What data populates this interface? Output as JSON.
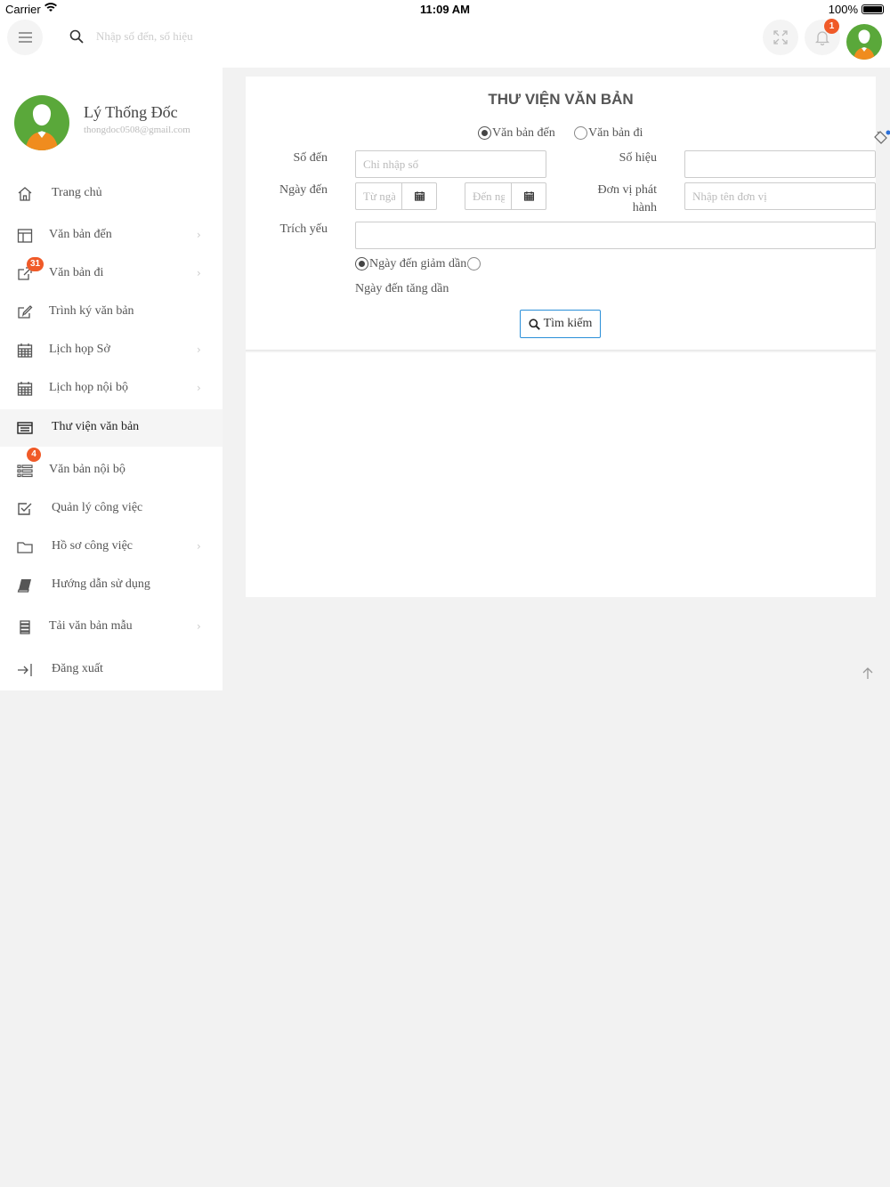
{
  "status_bar": {
    "carrier": "Carrier",
    "time": "11:09 AM",
    "battery": "100%"
  },
  "header": {
    "search_placeholder": "Nhập số đến, số hiệu",
    "notification_count": "1"
  },
  "profile": {
    "name": "Lý Thống Đốc",
    "email": "thongdoc0508@gmail.com"
  },
  "sidebar": {
    "items": [
      {
        "label": "Trang chủ",
        "icon": "home-icon",
        "has_chevron": false
      },
      {
        "label": "Văn bản đến",
        "icon": "inbox-doc-icon",
        "has_chevron": true
      },
      {
        "label": "Văn bản đi",
        "icon": "outbox-doc-icon",
        "has_chevron": true,
        "badge": "31"
      },
      {
        "label": "Trình ký văn bản",
        "icon": "edit-icon",
        "has_chevron": false
      },
      {
        "label": "Lịch họp Sở",
        "icon": "calendar-icon",
        "has_chevron": true
      },
      {
        "label": "Lịch họp nội bộ",
        "icon": "calendar-icon",
        "has_chevron": true
      },
      {
        "label": "Thư viện văn bản",
        "icon": "library-icon",
        "has_chevron": false,
        "active": true
      },
      {
        "label": "Văn bản nội bộ",
        "icon": "list-icon",
        "has_chevron": false,
        "badge": "4"
      },
      {
        "label": "Quản lý công việc",
        "icon": "checkbox-icon",
        "has_chevron": false
      },
      {
        "label": "Hồ sơ công việc",
        "icon": "folder-icon",
        "has_chevron": true
      },
      {
        "label": "Hướng dẫn sử dụng",
        "icon": "book-icon",
        "has_chevron": false
      },
      {
        "label": "Tải văn bản mẫu",
        "icon": "database-icon",
        "has_chevron": true
      },
      {
        "label": "Đăng xuất",
        "icon": "logout-icon",
        "has_chevron": false
      }
    ]
  },
  "form": {
    "title": "THƯ VIỆN VĂN BẢN",
    "doc_type_incoming": "Văn bản đến",
    "doc_type_outgoing": "Văn bản đi",
    "so_den_label": "Số đến",
    "so_den_placeholder": "Chỉ nhập số",
    "so_hieu_label": "Số hiệu",
    "so_hieu_value": "",
    "ngay_den_label": "Ngày đến",
    "from_date_placeholder": "Từ ngày",
    "to_date_placeholder": "Đến ngày",
    "don_vi_label_1": "Đơn vị phát",
    "don_vi_label_2": "hành",
    "don_vi_placeholder": "Nhập tên đơn vị",
    "trich_yeu_label": "Trích yếu",
    "trich_yeu_value": "",
    "sort_desc": "Ngày đến giảm dần",
    "sort_asc": "Ngày đến tăng dần",
    "search_button": "Tìm kiếm"
  },
  "colors": {
    "accent": "#2a8fd8",
    "badge": "#f05a28",
    "avatar": "#5aa83a"
  }
}
